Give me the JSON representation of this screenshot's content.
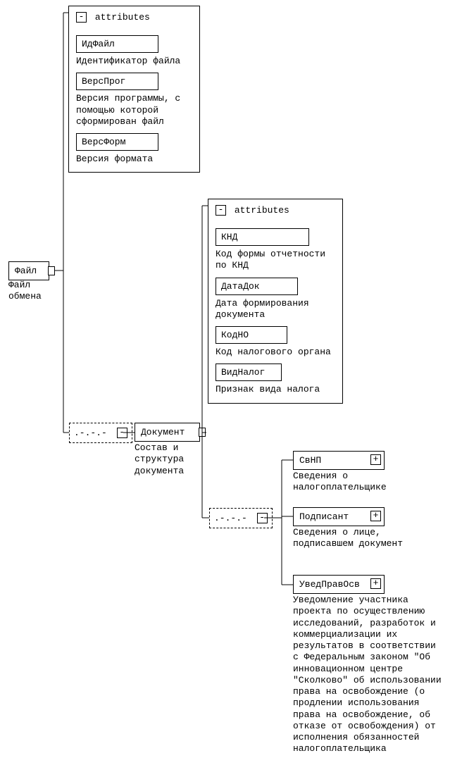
{
  "root": {
    "name": "Файл",
    "desc": "Файл обмена",
    "toggle": "-"
  },
  "attrs1": {
    "title": "attributes",
    "toggle": "-",
    "items": [
      {
        "name": "ИдФайл",
        "desc": "Идентификатор файла"
      },
      {
        "name": "ВерсПрог",
        "desc": "Версия программы, с помощью которой сформирован файл"
      },
      {
        "name": "ВерсФорм",
        "desc": "Версия формата"
      }
    ]
  },
  "seq1": {
    "dots": ".-.-.-",
    "toggle": "-"
  },
  "doc": {
    "name": "Документ",
    "desc": "Состав и структура документа",
    "toggle": "-"
  },
  "attrs2": {
    "title": "attributes",
    "toggle": "-",
    "items": [
      {
        "name": "КНД",
        "desc": "Код формы отчетности по КНД"
      },
      {
        "name": "ДатаДок",
        "desc": "Дата формирования документа"
      },
      {
        "name": "КодНО",
        "desc": "Код налогового органа"
      },
      {
        "name": "ВидНалог",
        "desc": "Признак вида налога"
      }
    ]
  },
  "seq2": {
    "dots": ".-.-.-",
    "toggle": "-"
  },
  "children": {
    "svnp": {
      "name": "СвНП",
      "desc": "Сведения о налогоплательщике",
      "toggle": "+"
    },
    "podpisant": {
      "name": "Подписант",
      "desc": "Сведения о лице, подписавшем документ",
      "toggle": "+"
    },
    "uved": {
      "name": "УведПравОсв",
      "desc": "Уведомление участника проекта по осуществлению исследований, разработок и коммерциализации их результатов в соответствии с Федеральным законом \"Об инновационном центре \"Сколково\" об использовании права на освобождение (о продлении использования права на освобождение, об отказе от освобождения) от исполнения обязанностей налогоплательщика",
      "toggle": "+"
    }
  }
}
